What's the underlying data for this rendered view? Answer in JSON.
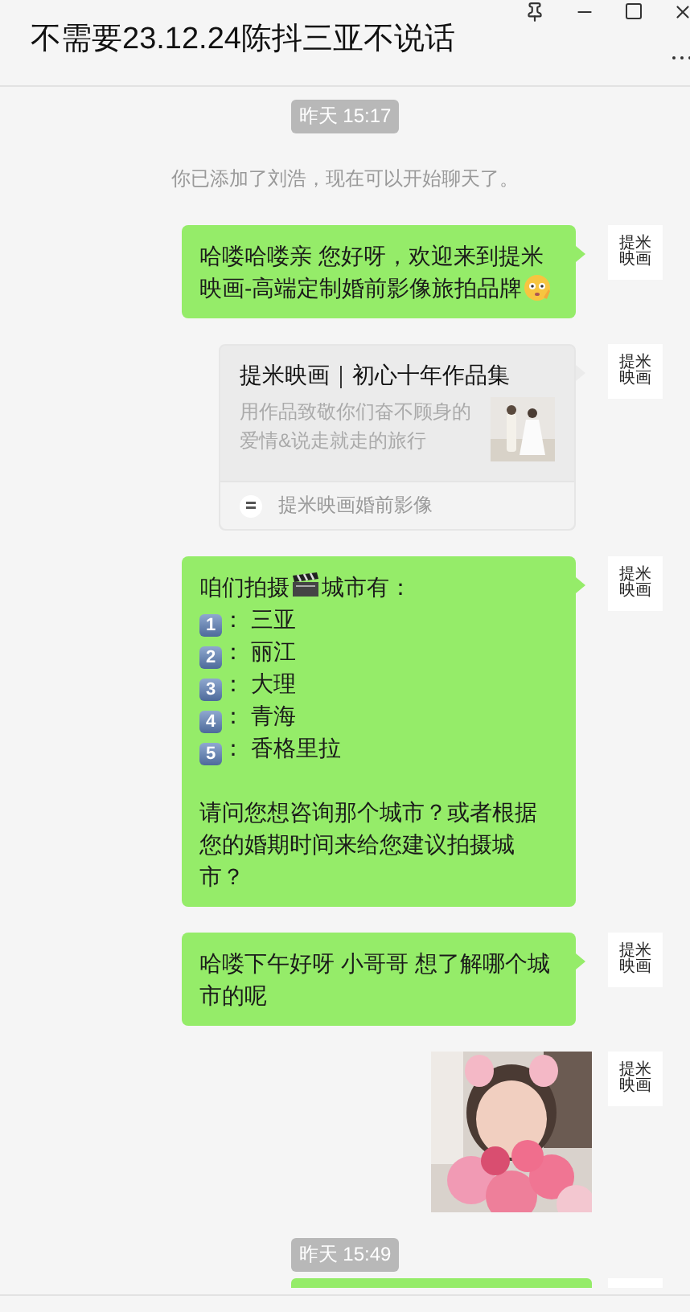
{
  "window": {
    "title": "不需要23.12.24陈抖三亚不说话"
  },
  "messages": [
    {
      "kind": "time",
      "text": "昨天 15:17"
    },
    {
      "kind": "system",
      "text": "你已添加了刘浩，现在可以开始聊天了。"
    },
    {
      "kind": "text",
      "avatar_text": "提米映画",
      "lines": [
        [
          {
            "kind": "text",
            "text": "哈喽哈喽亲 您好呀，欢迎来到提米映画-高端定制婚前影像旅拍品牌"
          },
          {
            "kind": "face"
          }
        ]
      ]
    },
    {
      "kind": "card",
      "avatar_text": "提米映画",
      "title": "提米映画｜初心十年作品集",
      "description": "用作品致敬你们奋不顾身的爱情&说走就走的旅行",
      "source": "提米映画婚前影像"
    },
    {
      "kind": "text",
      "avatar_text": "提米映画",
      "lines": [
        [
          {
            "kind": "text",
            "text": "咱们拍摄"
          },
          {
            "kind": "clapper"
          },
          {
            "kind": "text",
            "text": "城市有："
          }
        ],
        [
          {
            "kind": "keycap",
            "text": "1"
          },
          {
            "kind": "text",
            "text": "： 三亚"
          }
        ],
        [
          {
            "kind": "keycap",
            "text": "2"
          },
          {
            "kind": "text",
            "text": "： 丽江"
          }
        ],
        [
          {
            "kind": "keycap",
            "text": "3"
          },
          {
            "kind": "text",
            "text": "： 大理"
          }
        ],
        [
          {
            "kind": "keycap",
            "text": "4"
          },
          {
            "kind": "text",
            "text": "： 青海"
          }
        ],
        [
          {
            "kind": "keycap",
            "text": "5"
          },
          {
            "kind": "text",
            "text": "： 香格里拉"
          }
        ],
        [
          {
            "kind": "blank"
          }
        ],
        [
          {
            "kind": "text",
            "text": "请问您想咨询那个城市？或者根据您的婚期时间来给您建议拍摄城市？"
          }
        ]
      ]
    },
    {
      "kind": "text",
      "avatar_text": "提米映画",
      "lines": [
        [
          {
            "kind": "text",
            "text": "哈喽下午好呀 小哥哥 想了解哪个城市的呢"
          }
        ]
      ]
    },
    {
      "avatar_text": "提米映画"
    },
    {
      "kind": "time",
      "text": "昨天 15:49"
    },
    {
      "kind": "cut_bubble"
    }
  ]
}
